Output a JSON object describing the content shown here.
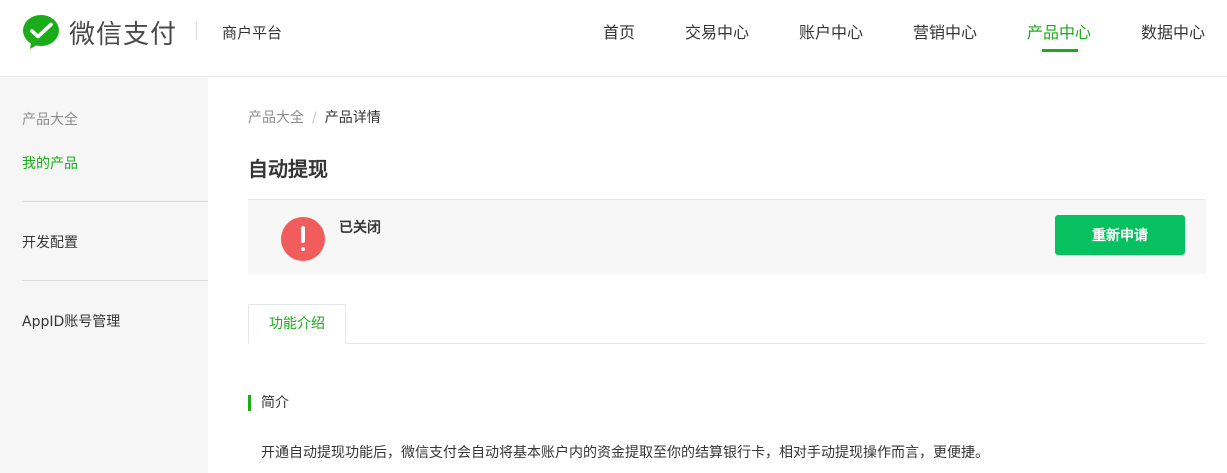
{
  "brand": {
    "name": "微信支付",
    "platform": "商户平台",
    "accent_color": "#1aad19"
  },
  "nav": {
    "items": [
      {
        "label": "首页"
      },
      {
        "label": "交易中心"
      },
      {
        "label": "账户中心"
      },
      {
        "label": "营销中心"
      },
      {
        "label": "产品中心",
        "active": true
      },
      {
        "label": "数据中心"
      }
    ]
  },
  "sidebar": {
    "group_title": "产品大全",
    "items": [
      {
        "label": "我的产品",
        "active": true
      },
      {
        "label": "开发配置"
      },
      {
        "label": "AppID账号管理"
      }
    ]
  },
  "breadcrumb": {
    "parent": "产品大全",
    "separator": "/",
    "current": "产品详情"
  },
  "page": {
    "title": "自动提现"
  },
  "status": {
    "icon": "exclamation-circle-icon",
    "color": "#f15c5c",
    "text": "已关闭",
    "action_label": "重新申请",
    "action_color": "#07c160"
  },
  "tabs": [
    {
      "label": "功能介绍",
      "active": true
    }
  ],
  "intro": {
    "title": "简介",
    "text": "开通自动提现功能后，微信支付会自动将基本账户内的资金提取至你的结算银行卡，相对手动提现操作而言，更便捷。"
  }
}
